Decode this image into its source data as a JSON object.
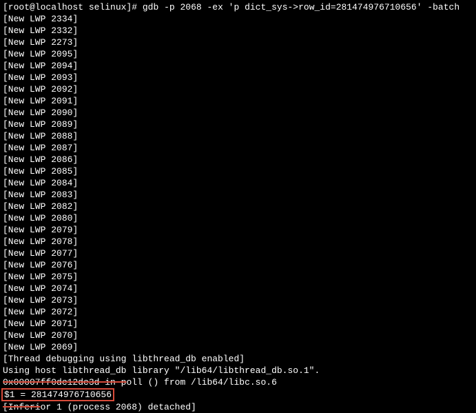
{
  "prompt": {
    "user_host": "[root@localhost selinux]#",
    "command": "gdb -p 2068 -ex 'p dict_sys->row_id=281474976710656' -batch"
  },
  "lwp_lines": [
    "[New LWP 2334]",
    "[New LWP 2332]",
    "[New LWP 2273]",
    "[New LWP 2095]",
    "[New LWP 2094]",
    "[New LWP 2093]",
    "[New LWP 2092]",
    "[New LWP 2091]",
    "[New LWP 2090]",
    "[New LWP 2089]",
    "[New LWP 2088]",
    "[New LWP 2087]",
    "[New LWP 2086]",
    "[New LWP 2085]",
    "[New LWP 2084]",
    "[New LWP 2083]",
    "[New LWP 2082]",
    "[New LWP 2080]",
    "[New LWP 2079]",
    "[New LWP 2078]",
    "[New LWP 2077]",
    "[New LWP 2076]",
    "[New LWP 2075]",
    "[New LWP 2074]",
    "[New LWP 2073]",
    "[New LWP 2072]",
    "[New LWP 2071]",
    "[New LWP 2070]",
    "[New LWP 2069]"
  ],
  "thread_dbg": "[Thread debugging using libthread_db enabled]",
  "host_lib": "Using host libthread_db library \"/lib64/libthread_db.so.1\".",
  "poll_line_strike": "0x00007ff0dc12dc3d in p",
  "poll_line_rest": "oll () from /lib64/libc.so.6",
  "result": "$1 = 281474976710656",
  "inferior_pre": "[Inferi",
  "inferior_rest": "or 1 (process 2068) detached]"
}
